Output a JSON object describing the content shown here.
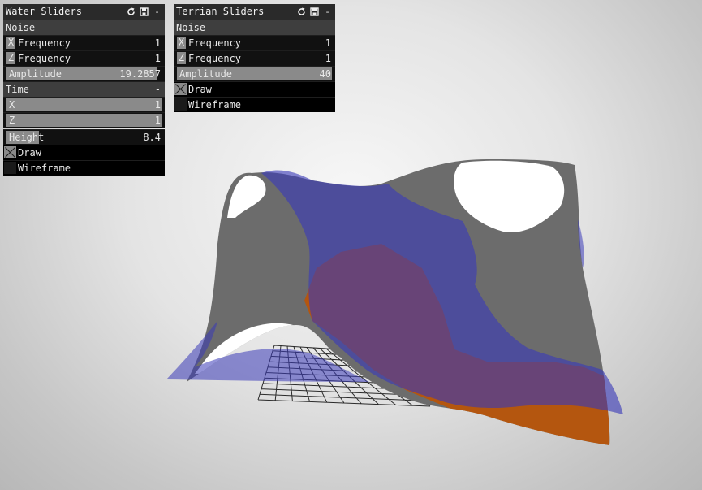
{
  "water_panel": {
    "title": "Water Sliders",
    "collapse_symbol": "-",
    "noise": {
      "label": "Noise",
      "x_frequency": {
        "axis": "X",
        "label": "Frequency",
        "value": "1",
        "fill": 0.0
      },
      "z_frequency": {
        "axis": "Z",
        "label": "Frequency",
        "value": "1",
        "fill": 0.0
      },
      "amplitude": {
        "label": "Amplitude",
        "value": "19.2857",
        "fill": 0.97
      }
    },
    "time": {
      "label": "Time",
      "x": {
        "axis": "X",
        "value": "1",
        "fill": 1.0
      },
      "z": {
        "axis": "Z",
        "value": "1",
        "fill": 1.0
      }
    },
    "height": {
      "label": "Height",
      "value": "8.4",
      "fill": 0.21
    },
    "draw": {
      "label": "Draw",
      "checked": true
    },
    "wireframe": {
      "label": "Wireframe",
      "checked": false
    }
  },
  "terrain_panel": {
    "title": "Terrian Sliders",
    "collapse_symbol": "-",
    "noise": {
      "label": "Noise",
      "x_frequency": {
        "axis": "X",
        "label": "Frequency",
        "value": "1",
        "fill": 0.0
      },
      "z_frequency": {
        "axis": "Z",
        "label": "Frequency",
        "value": "1",
        "fill": 0.0
      },
      "amplitude": {
        "label": "Amplitude",
        "value": "40",
        "fill": 1.0
      }
    },
    "draw": {
      "label": "Draw",
      "checked": true
    },
    "wireframe": {
      "label": "Wireframe",
      "checked": false
    }
  },
  "icons": {
    "refresh": "refresh-icon",
    "save": "save-icon"
  },
  "scene_colors": {
    "background": "#e6e6e6",
    "terrain": "#6c6c6c",
    "snow": "#ffffff",
    "water": "#3a3ab8",
    "low_terrain": "#b4560f",
    "grid": "#2a2a2a"
  }
}
